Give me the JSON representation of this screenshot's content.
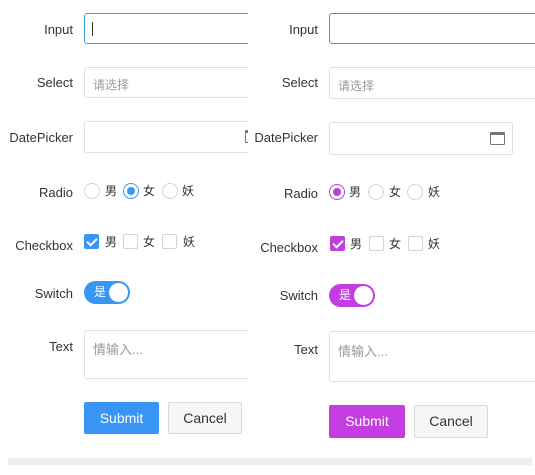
{
  "left_form": {
    "labels": {
      "input": "Input",
      "select": "Select",
      "datepicker": "DatePicker",
      "radio": "Radio",
      "checkbox": "Checkbox",
      "switch": "Switch",
      "text": "Text"
    },
    "select_placeholder": "请选择",
    "radio_options": [
      "男",
      "女",
      "妖"
    ],
    "radio_selected": "女",
    "checkbox_options": [
      "男",
      "女",
      "妖"
    ],
    "checkbox_checked": [
      "男"
    ],
    "switch_label": "是",
    "switch_on": true,
    "text_placeholder": "情输入...",
    "submit_label": "Submit",
    "cancel_label": "Cancel",
    "accent_color": "#3996f5"
  },
  "right_form": {
    "labels": {
      "input": "Input",
      "select": "Select",
      "datepicker": "DatePicker",
      "radio": "Radio",
      "checkbox": "Checkbox",
      "switch": "Switch",
      "text": "Text"
    },
    "select_placeholder": "请选择",
    "radio_options": [
      "男",
      "女",
      "妖"
    ],
    "radio_selected": "男",
    "checkbox_options": [
      "男",
      "女",
      "妖"
    ],
    "checkbox_checked": [
      "男"
    ],
    "switch_label": "是",
    "switch_on": true,
    "text_placeholder": "情输入...",
    "submit_label": "Submit",
    "cancel_label": "Cancel",
    "accent_color": "#c33ee0"
  }
}
